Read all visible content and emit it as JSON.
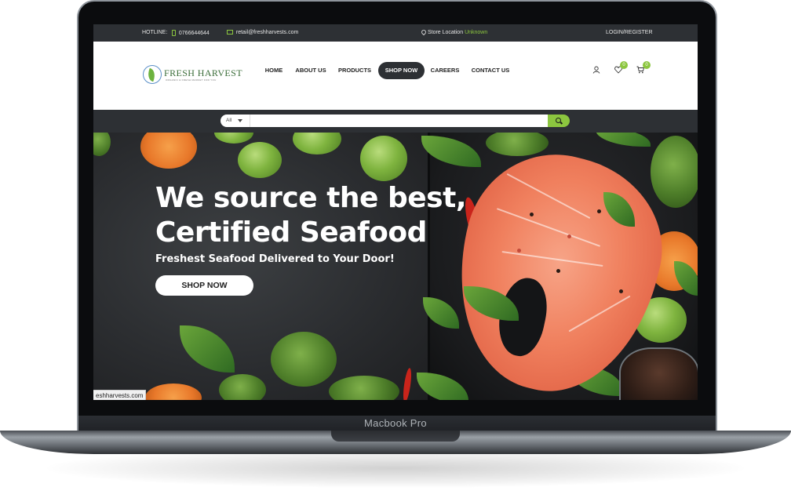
{
  "topbar": {
    "hotline_label": "HOTLINE:",
    "phone": "0766644644",
    "email": "retail@freshharvests.com",
    "store_location_label": "Store Location",
    "store_location_value": "Unknown",
    "login": "LOGIN/REGISTER"
  },
  "header": {
    "logo_name": "FRESH HARVEST",
    "logo_tagline": "ORGANIC & FRESH MARKET FOR YOU",
    "nav": [
      "HOME",
      "ABOUT US",
      "PRODUCTS",
      "SHOP NOW",
      "CAREERS",
      "CONTACT US"
    ],
    "active_nav": "SHOP NOW",
    "wishlist_count": "0",
    "cart_count": "0"
  },
  "search": {
    "category": "All",
    "placeholder": ""
  },
  "hero": {
    "title_line1": "We source the best,",
    "title_line2": "Certified Seafood",
    "subtitle": "Freshest Seafood Delivered to Your Door!",
    "cta": "SHOP NOW"
  },
  "status_url": "eshharvests.com",
  "device_label": "Macbook Pro",
  "colors": {
    "accent_green": "#8cc63f",
    "dark_bar": "#2d3034"
  }
}
